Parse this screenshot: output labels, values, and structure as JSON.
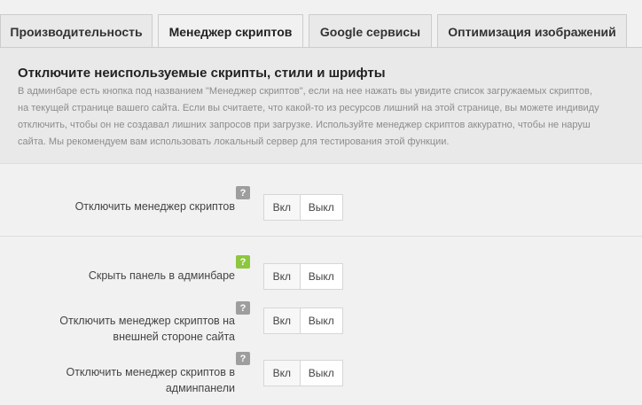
{
  "tabs": [
    {
      "label": "Производительность",
      "active": false
    },
    {
      "label": "Менеджер скриптов",
      "active": true
    },
    {
      "label": "Google сервисы",
      "active": false
    },
    {
      "label": "Оптимизация изображений",
      "active": false
    }
  ],
  "notice": {
    "title": "Отключите неиспользуемые скрипты, стили и шрифты",
    "lines": [
      "В админбаре есть кнопка под названием \"Менеджер скриптов\", если на нее нажать вы увидите список загружаемых скриптов,",
      "на текущей странице вашего сайта. Если вы считаете, что какой-то из ресурсов лишний на этой странице, вы можете индивиду",
      "отключить, чтобы он не создавал лишних запросов при загрузке. Используйте менеджер скриптов аккуратно, чтобы не наруш",
      "сайта. Мы рекомендуем вам использовать локальный сервер для тестирования этой функции."
    ]
  },
  "settings": [
    {
      "label_lines": [
        "Отключить менеджер скриптов"
      ],
      "help": "?",
      "help_color": "#9e9e9e",
      "on": "Вкл",
      "off": "Выкл"
    },
    {
      "label_lines": [
        "Скрыть панель в админбаре"
      ],
      "help": "?",
      "help_color": "#8dc63f",
      "on": "Вкл",
      "off": "Выкл"
    },
    {
      "label_lines": [
        "Отключить менеджер скриптов на",
        "внешней стороне сайта"
      ],
      "help": "?",
      "help_color": "#9e9e9e",
      "on": "Вкл",
      "off": "Выкл"
    },
    {
      "label_lines": [
        "Отключить менеджер скриптов в",
        "админпанели"
      ],
      "help": "?",
      "help_color": "#9e9e9e",
      "on": "Вкл",
      "off": "Выкл"
    }
  ]
}
